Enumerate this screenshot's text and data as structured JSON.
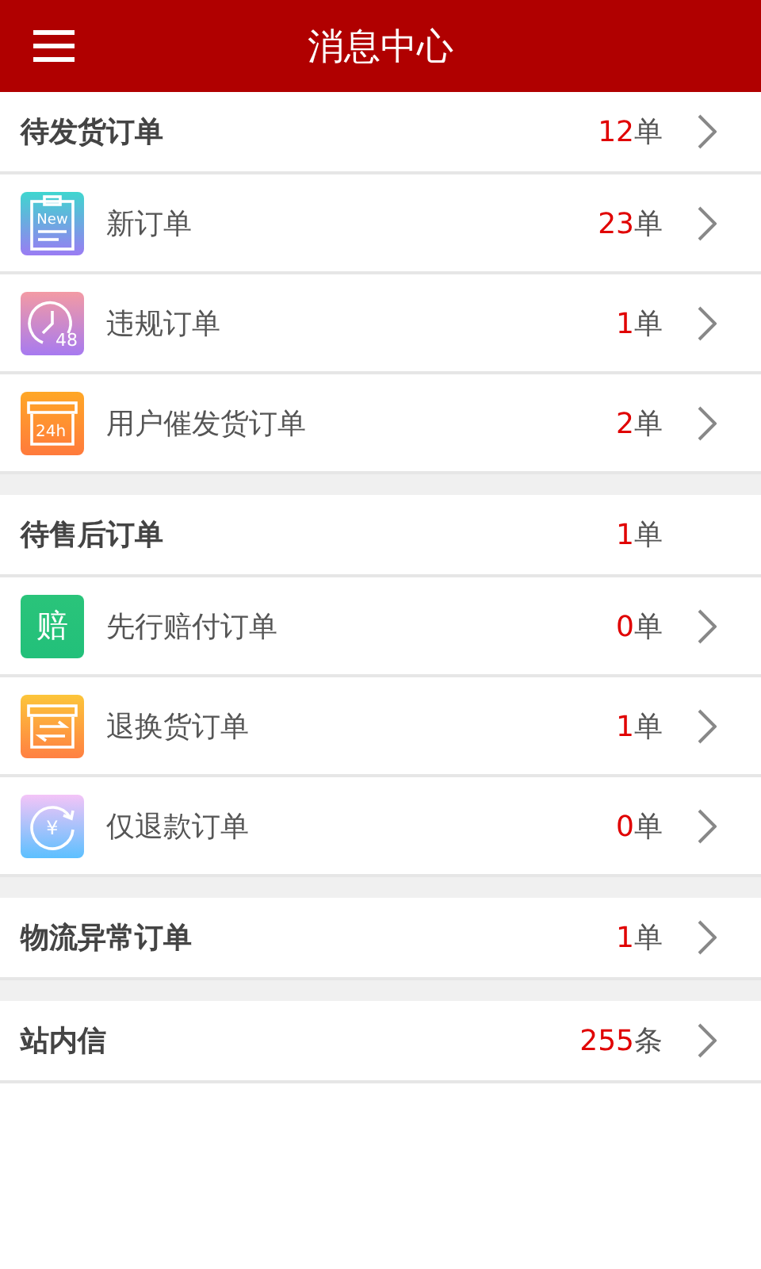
{
  "header": {
    "title": "消息中心"
  },
  "sections": [
    {
      "title": "待发货订单",
      "count": "12",
      "unit": "单",
      "arrow": true,
      "items": [
        {
          "label": "新订单",
          "count": "23",
          "unit": "单",
          "arrow": true,
          "kind": "clipboard",
          "icon_text": "New"
        },
        {
          "label": "违规订单",
          "count": "1",
          "unit": "单",
          "arrow": true,
          "kind": "clock",
          "icon_text": "48"
        },
        {
          "label": "用户催发货订单",
          "count": "2",
          "unit": "单",
          "arrow": true,
          "kind": "box",
          "icon_text": "24h"
        }
      ]
    },
    {
      "title": "待售后订单",
      "count": "1",
      "unit": "单",
      "arrow": false,
      "items": [
        {
          "label": "先行赔付订单",
          "count": "0",
          "unit": "单",
          "arrow": true,
          "kind": "glyph",
          "icon_text": "赔"
        },
        {
          "label": "退换货订单",
          "count": "1",
          "unit": "单",
          "arrow": true,
          "kind": "swap"
        },
        {
          "label": "仅退款订单",
          "count": "0",
          "unit": "单",
          "arrow": true,
          "kind": "refund",
          "icon_text": "¥"
        }
      ]
    },
    {
      "title": "物流异常订单",
      "count": "1",
      "unit": "单",
      "arrow": true
    },
    {
      "title": "站内信",
      "count": "255",
      "unit": "条",
      "arrow": true
    }
  ]
}
